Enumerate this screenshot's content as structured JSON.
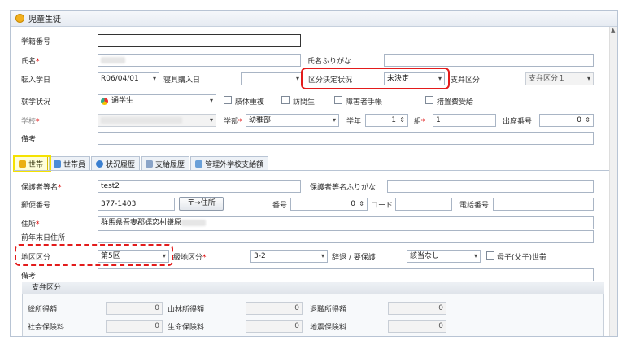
{
  "window": {
    "title": "児童生徒"
  },
  "student": {
    "gakuseki_label": "学籍番号",
    "name_label": "氏名",
    "kana_label": "氏名ふりがな",
    "transfer_date_label": "転入学日",
    "transfer_date_value": "R06/04/01",
    "shingu_label": "寝具購入日",
    "kubun_status_label": "区分決定状況",
    "kubun_status_value": "未決定",
    "shiben_label": "支弁区分",
    "shiben_value": "支弁区分１",
    "shugaku_label": "就学状況",
    "shugaku_value": "通学生",
    "chk1": "肢体重複",
    "chk2": "訪問生",
    "chk3": "障害者手帳",
    "chk4": "措置費受給",
    "school_label": "学校",
    "gakubu_label": "学部",
    "gakubu_value": "幼稚部",
    "gakunen_label": "学年",
    "gakunen_value": "1",
    "kumi_label": "組",
    "kumi_value": "1",
    "shusseki_label": "出席番号",
    "shusseki_value": "0",
    "biko_label": "備考"
  },
  "tabs": [
    {
      "label": "世帯"
    },
    {
      "label": "世帯員"
    },
    {
      "label": "状況履歴"
    },
    {
      "label": "支給履歴"
    },
    {
      "label": "管理外学校支給額"
    }
  ],
  "household": {
    "guardian_label": "保護者等名",
    "guardian_value": "test2",
    "guardian_kana_label": "保護者等名ふりがな",
    "postal_label": "郵便番号",
    "postal_value": "377-1403",
    "postal_button": "〒→住所",
    "bango_label": "番号",
    "bango_value": "0",
    "code_label": "コード",
    "tel_label": "電話番号",
    "address_label": "住所",
    "address_value": "群馬県吾妻郡嬬恋村鎌原",
    "prev_address_label": "前年末日住所",
    "chiku_label": "地区区分",
    "chiku_value": "第5区",
    "kyuchi_label": "級地区分",
    "kyuchi_value": "3-2",
    "jitai_label": "辞退 / 要保護",
    "jitai_value": "該当なし",
    "boshi_label": "母子(父子)世帯",
    "biko_label": "備考"
  },
  "shiben_group": {
    "title": "支弁区分",
    "rows": [
      [
        {
          "label": "総所得額",
          "value": "0"
        },
        {
          "label": "山林所得額",
          "value": "0"
        },
        {
          "label": "退職所得額",
          "value": "0"
        }
      ],
      [
        {
          "label": "社会保険料",
          "value": "0"
        },
        {
          "label": "生命保険料",
          "value": "0"
        },
        {
          "label": "地震保険料",
          "value": "0"
        }
      ]
    ]
  }
}
